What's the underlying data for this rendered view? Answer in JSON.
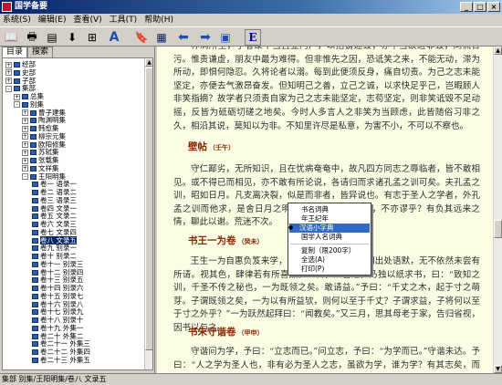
{
  "window": {
    "title": "国学备要"
  },
  "menu": [
    "系统(S)",
    "编辑(E)",
    "查看(V)",
    "工具(T)",
    "帮助(H)"
  ],
  "toolbar": {
    "e_label": "E"
  },
  "left_tabs": [
    "目录",
    "搜索"
  ],
  "tree": [
    {
      "label": "经部",
      "indent": 0,
      "pm": "+"
    },
    {
      "label": "史部",
      "indent": 0,
      "pm": "+"
    },
    {
      "label": "子部",
      "indent": 0,
      "pm": "+"
    },
    {
      "label": "集部",
      "indent": 0,
      "pm": "-"
    },
    {
      "label": "总集",
      "indent": 1,
      "pm": "+"
    },
    {
      "label": "别集",
      "indent": 1,
      "pm": "-"
    },
    {
      "label": "曹子建集",
      "indent": 2,
      "pm": "+"
    },
    {
      "label": "陶渊明集",
      "indent": 2,
      "pm": "+"
    },
    {
      "label": "韩愈集",
      "indent": 2,
      "pm": "+"
    },
    {
      "label": "柳宗元集",
      "indent": 2,
      "pm": "+"
    },
    {
      "label": "欧阳修集",
      "indent": 2,
      "pm": "+"
    },
    {
      "label": "苏轼集",
      "indent": 2,
      "pm": "+"
    },
    {
      "label": "张载集",
      "indent": 2,
      "pm": "+"
    },
    {
      "label": "文祥集",
      "indent": 2,
      "pm": "+"
    },
    {
      "label": "王阳明集",
      "indent": 2,
      "pm": "-"
    },
    {
      "label": "卷一 语录一",
      "indent": 3
    },
    {
      "label": "卷二 语录二",
      "indent": 3
    },
    {
      "label": "卷三 语录三",
      "indent": 3
    },
    {
      "label": "卷四 文录一",
      "indent": 3
    },
    {
      "label": "卷五 文录二",
      "indent": 3
    },
    {
      "label": "卷六 文录三",
      "indent": 3
    },
    {
      "label": "卷七 文录四",
      "indent": 3
    },
    {
      "label": "卷八 文录五",
      "indent": 3,
      "selected": true
    },
    {
      "label": "卷九 别录一",
      "indent": 3
    },
    {
      "label": "卷十 别录二",
      "indent": 3
    },
    {
      "label": "卷十一 别录三",
      "indent": 3
    },
    {
      "label": "卷十二 别录四",
      "indent": 3
    },
    {
      "label": "卷十三 别录五",
      "indent": 3
    },
    {
      "label": "卷十四 别录六",
      "indent": 3
    },
    {
      "label": "卷十五 别录七",
      "indent": 3
    },
    {
      "label": "卷十六 别录八",
      "indent": 3
    },
    {
      "label": "卷十七 别录九",
      "indent": 3
    },
    {
      "label": "卷十八 别录十",
      "indent": 3
    },
    {
      "label": "卷十九 外集一",
      "indent": 3
    },
    {
      "label": "卷二十 外集二",
      "indent": 3
    },
    {
      "label": "卷二十一 外集三",
      "indent": 3
    },
    {
      "label": "卷二十二 外集四",
      "indent": 3
    },
    {
      "label": "卷二十三 外集五",
      "indent": 3
    }
  ],
  "reader": {
    "p1": "称病所至，学者聚不当且立门户，以招谤速毁；亦不当故避非毁，同流合污。惟贵谦虚，朋友中最为难得。但非惟先之因，恐诋笑之来，不能无动，滞为所动，即惧何隐忍。久将论者以溺。每到此便须反身，痛自切责。为己之志未能坚定，亦便去气激昂奋发。但知明己之善，立己之诚，以求快足乎己，岂暇顾人非笑指摘？故学者只须责自家为己之志未能坚定，志苟坚定，则非笑诋毁不足动摇，反皆为砥砺切磋之地矣。今时人多言人之非笑为当顾虑，此皆随俗习非之久，相沿其说，莫知以为非。不知里许尽是私意，为害不小，不可以不察也。",
    "h1": "壁帖",
    "h1s": "（壬午）",
    "p2": "守仁鄙劣，无所知识，且在忧病奄奄中，故凡四方同志之辱临者，皆不敢相见。或不得已而相见，亦不敢有所论说，各请归而求诸孔孟之训可矣。夫孔孟之训，昭如日月。凡支离决裂，似是而非者，皆异说也。有志于圣人之学者，外孔孟之训而他求，是舍日月之明而希光于萤爝之微也，不亦谬乎？有负其远来之情，聊此以谢。荒迷不次。",
    "h2": "书王一为卷",
    "h2s": "（癸未）",
    "p3": "王生一为自惠负笈来学，朝夕相与者三月，其间出处语默，无不依然未尝有所请。视其色，肆律若有所喜然。一日，众皆退，乃独以纸求书，曰：“致知之训，千圣不传之秘也，一为既领之矣。敢请益。”予曰：“千丈之木，起于寸之萌芽。子谓既领之矣，一为以有所益欤，则何以至于千丈？子谓求益，子将何以至于寸之外乎？”一为跃然起拜曰：“闻教矣。”又三月，思其母老于家，告归省视，因书以与之。",
    "h3": "书朱守谐卷",
    "h3s": "（甲申）",
    "p4": "守谐问为学，予曰：“立志而已。”问立志，予曰：“为学而已。”守谐未达。予曰：“人之学为圣人也，非有必为圣人之志，虽欲为学，谁为学？有其志矣，而不"
  },
  "context_menu": {
    "items": [
      "书名词典",
      "年王纪年",
      "汉语小字典",
      "国学人名词典"
    ],
    "checked_index": 2,
    "copy": "复制（限200字）",
    "select_all": "全选(A)",
    "print": "打印(P)"
  },
  "status": "集部 别集/王阳明集/卷八 文录五"
}
